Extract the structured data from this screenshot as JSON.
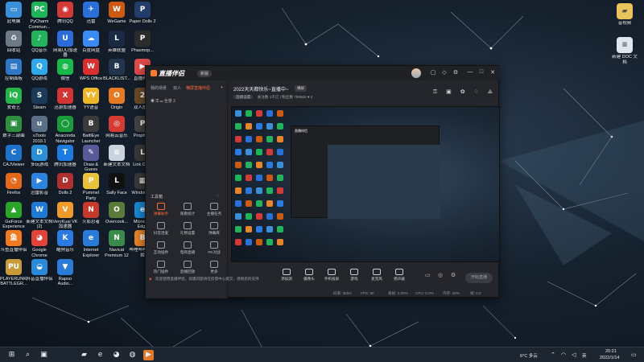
{
  "desktop": {
    "icons": [
      {
        "label": "此电脑",
        "icon": "computer-icon",
        "color": "#3b8fd9",
        "glyph": "▭"
      },
      {
        "label": "PyCharm Commun...",
        "icon": "pycharm-icon",
        "color": "#1fb45a",
        "glyph": "PC"
      },
      {
        "label": "腾讯QQ",
        "icon": "qq-icon",
        "color": "#d23a3a",
        "glyph": "◉"
      },
      {
        "label": "迅雷",
        "icon": "xunlei-icon",
        "color": "#2b6fd9",
        "glyph": "✈"
      },
      {
        "label": "WeGame",
        "icon": "wegame-icon",
        "color": "#cc5a12",
        "glyph": "W"
      },
      {
        "label": "Paper Dolls 2",
        "icon": "paperdolls-icon",
        "color": "#233d6b",
        "glyph": "P"
      },
      {
        "label": "回收站",
        "icon": "recycle-bin-icon",
        "color": "#6c7a88",
        "glyph": "♻"
      },
      {
        "label": "QQ音乐",
        "icon": "qqmusic-icon",
        "color": "#24b35c",
        "glyph": "♪"
      },
      {
        "label": "网易UU加速器",
        "icon": "uu-icon",
        "color": "#2c6bd8",
        "glyph": "U"
      },
      {
        "label": "百度网盘",
        "icon": "baidupan-icon",
        "color": "#3a8bf5",
        "glyph": "☁"
      },
      {
        "label": "英雄联盟",
        "icon": "lol-icon",
        "color": "#1a2a44",
        "glyph": "L"
      },
      {
        "label": "Phasmop...",
        "icon": "phasmophobia-icon",
        "color": "#2b2b2b",
        "glyph": "P"
      },
      {
        "label": "控制面板",
        "icon": "control-panel-icon",
        "color": "#2f77c5",
        "glyph": "▤"
      },
      {
        "label": "QQ游戏",
        "icon": "qqgame-icon",
        "color": "#2ea8e8",
        "glyph": "Q"
      },
      {
        "label": "微信",
        "icon": "wechat-icon",
        "color": "#19b84a",
        "glyph": "◍"
      },
      {
        "label": "WPS Office",
        "icon": "wps-icon",
        "color": "#d92f2f",
        "glyph": "W"
      },
      {
        "label": "BLACKLIST...",
        "icon": "blacklist-icon",
        "color": "#23354c",
        "glyph": "B"
      },
      {
        "label": "直播伴侣",
        "icon": "live-companion-icon",
        "color": "#e04a4a",
        "glyph": "▶"
      },
      {
        "label": "爱奇艺",
        "icon": "iqiyi-icon",
        "color": "#25b34a",
        "glyph": "iQ"
      },
      {
        "label": "Steam",
        "icon": "steam-icon",
        "color": "#1b3a5a",
        "glyph": "S"
      },
      {
        "label": "迅游加速器",
        "icon": "xunyou-icon",
        "color": "#d23333",
        "glyph": "X"
      },
      {
        "label": "YY语音",
        "icon": "yy-icon",
        "color": "#f0b62a",
        "glyph": "YY"
      },
      {
        "label": "Origin",
        "icon": "origin-icon",
        "color": "#e57a22",
        "glyph": "O"
      },
      {
        "label": "双人成行",
        "icon": "ittakestwo-icon",
        "color": "#6b4a2a",
        "glyph": "2"
      },
      {
        "label": "数字三部曲",
        "icon": "game-icon",
        "color": "#2e8f3e",
        "glyph": "▣"
      },
      {
        "label": "uTools 2019.1",
        "icon": "utools-icon",
        "color": "#5a6f86",
        "glyph": "u"
      },
      {
        "label": "Anaconda Navigator",
        "icon": "anaconda-icon",
        "color": "#1a9a3a",
        "glyph": "◯"
      },
      {
        "label": "BattlEye Launcher",
        "icon": "battleye-icon",
        "color": "#3b3b3b",
        "glyph": "B"
      },
      {
        "label": "网易云音乐",
        "icon": "netease-music-icon",
        "color": "#d43c33",
        "glyph": "◎"
      },
      {
        "label": "Propha...",
        "icon": "prophet-icon",
        "color": "#444",
        "glyph": "P"
      },
      {
        "label": "CAJViewer",
        "icon": "cajviewer-icon",
        "color": "#1e72c9",
        "glyph": "C"
      },
      {
        "label": "多玩游戏",
        "icon": "duowan-icon",
        "color": "#2a8fd6",
        "glyph": "D"
      },
      {
        "label": "腾讯加速器",
        "icon": "tencent-accel-icon",
        "color": "#1d7be0",
        "glyph": "T"
      },
      {
        "label": "Draw & Guess",
        "icon": "drawguess-icon",
        "color": "#5a5a9a",
        "glyph": "✎"
      },
      {
        "label": "新建文本文档",
        "icon": "text-file-icon",
        "color": "#c9d2dc",
        "glyph": "≡"
      },
      {
        "label": "Link Ga...",
        "icon": "link-icon",
        "color": "#3a3a3a",
        "glyph": "L"
      },
      {
        "label": "Firefox",
        "icon": "firefox-icon",
        "color": "#e2681c",
        "glyph": "◔"
      },
      {
        "label": "迅雷影音",
        "icon": "xunlei-player-icon",
        "color": "#2c84e0",
        "glyph": "▶"
      },
      {
        "label": "Dolls 2",
        "icon": "dolls-icon",
        "color": "#b03030",
        "glyph": "D"
      },
      {
        "label": "Pummel Party",
        "icon": "pummel-icon",
        "color": "#e8c23a",
        "glyph": "P"
      },
      {
        "label": "Sally Face",
        "icon": "sallyface-icon",
        "color": "#111",
        "glyph": "L"
      },
      {
        "label": "Windows...",
        "icon": "windows-app-icon",
        "color": "#3a3a3a",
        "glyph": "▦"
      },
      {
        "label": "GeForce Experience",
        "icon": "geforce-icon",
        "color": "#2aa52a",
        "glyph": "▲"
      },
      {
        "label": "新建文本文档 (2)",
        "icon": "text-file-icon",
        "color": "#1e7ad6",
        "glyph": "W"
      },
      {
        "label": "VeryKuai VK加速器",
        "icon": "verykuai-icon",
        "color": "#f09a2a",
        "glyph": "V"
      },
      {
        "label": "火影忍者",
        "icon": "naruto-icon",
        "color": "#c53a2a",
        "glyph": "N"
      },
      {
        "label": "Overcook...",
        "icon": "overcooked-icon",
        "color": "#5a7a3a",
        "glyph": "O"
      },
      {
        "label": "Microsoft Edge",
        "icon": "edge-icon",
        "color": "#1a8ad6",
        "glyph": "e"
      },
      {
        "label": "斗鱼直播伴侣",
        "icon": "douyu-icon",
        "color": "#f07a22",
        "glyph": "鱼"
      },
      {
        "label": "Google Chrome",
        "icon": "chrome-icon",
        "color": "#e2443a",
        "glyph": "◕"
      },
      {
        "label": "酷狗音乐",
        "icon": "kugou-icon",
        "color": "#2a7ae0",
        "glyph": "K"
      },
      {
        "label": "Internet Explorer",
        "icon": "ie-icon",
        "color": "#2a7ad8",
        "glyph": "e"
      },
      {
        "label": "Navicat Premium 12",
        "icon": "navicat-icon",
        "color": "#3a8a4a",
        "glyph": "N"
      },
      {
        "label": "哔哩哔哩直播姬",
        "icon": "bilibili-icon",
        "color": "#e8852a",
        "glyph": "B"
      },
      {
        "label": "PLAYERUNKNOWN'S BATTLEGR...",
        "icon": "pubg-icon",
        "color": "#c99a3a",
        "glyph": "PU"
      },
      {
        "label": "抖音直播伴侣",
        "icon": "douyin-icon",
        "color": "#2a8ad8",
        "glyph": "◒"
      },
      {
        "label": "Rapoo Audio...",
        "icon": "rapoo-icon",
        "color": "#2a7ad6",
        "glyph": "▼"
      }
    ],
    "right_icons": [
      {
        "label": "音视频",
        "icon": "folder-icon",
        "color": "#e8c45a",
        "glyph": "▰"
      },
      {
        "label": "新建 DOC 文档",
        "icon": "doc-file-icon",
        "color": "#dfe6ee",
        "glyph": "≡"
      }
    ]
  },
  "app": {
    "logo": "直播伴侣",
    "version": "新版",
    "window_controls": [
      "—",
      "□",
      "✕"
    ],
    "left_tabs": [
      {
        "label": "我的场景",
        "active": false
      },
      {
        "label": "双人",
        "active": false
      },
      {
        "label": "横屏直播伴侣",
        "active": true
      }
    ],
    "scene_label": "全景 2",
    "tools_title": "工具箱",
    "tools": [
      {
        "label": "弹幕助手",
        "hot": true
      },
      {
        "label": "观看统计",
        "hot": false
      },
      {
        "label": "主播任务",
        "hot": false
      },
      {
        "label": "抖音连麦",
        "hot": false
      },
      {
        "label": "礼物设置",
        "hot": false
      },
      {
        "label": "弹幕库",
        "hot": false
      },
      {
        "label": "互动插件",
        "hot": false
      },
      {
        "label": "电商直播",
        "hot": false
      },
      {
        "label": "PK对战",
        "hot": false
      },
      {
        "label": "热门插件",
        "hot": false
      },
      {
        "label": "直播回放",
        "hot": false
      },
      {
        "label": "更多",
        "hot": false
      }
    ],
    "notice": "欢迎使用直播伴侣，如遇问题请在反馈中心提交，感谢您的支持",
    "stream_title": "2022天天都快乐~直播中~",
    "stream_tag": "横屏",
    "stream_sub": [
      "直播设置",
      "关注数 1千亿 | 粉丝数 789502"
    ],
    "likes": "4",
    "controls": [
      {
        "label": "添加源",
        "icon": "add-source-icon"
      },
      {
        "label": "摄像头",
        "icon": "camera-icon"
      },
      {
        "label": "手机投屏",
        "icon": "phone-cast-icon"
      },
      {
        "label": "游戏",
        "icon": "game-source-icon"
      },
      {
        "label": "麦克风",
        "icon": "mic-icon"
      },
      {
        "label": "扬声器",
        "icon": "speaker-icon"
      }
    ],
    "start_label": "开始直播",
    "stats": [
      "码率: 0kb/s",
      "FPS: 60",
      "丢帧: 0.00%",
      "CPU: 5.0%",
      "内存: 46%",
      "帧: 0.0"
    ]
  },
  "taskbar": {
    "weather": "6°C 多云",
    "time": "20:21",
    "date": "2022/1/14",
    "ime": "英",
    "pinned": [
      {
        "icon": "windows-start-icon",
        "glyph": "⊞"
      },
      {
        "icon": "search-icon",
        "glyph": "⌕"
      },
      {
        "icon": "task-view-icon",
        "glyph": "▣"
      },
      {
        "icon": "file-explorer-icon",
        "glyph": "▰"
      },
      {
        "icon": "edge-icon",
        "glyph": "e"
      },
      {
        "icon": "chrome-icon",
        "glyph": "◕"
      },
      {
        "icon": "wechat-icon",
        "glyph": "◍"
      },
      {
        "icon": "live-companion-icon",
        "glyph": "▶"
      }
    ]
  }
}
